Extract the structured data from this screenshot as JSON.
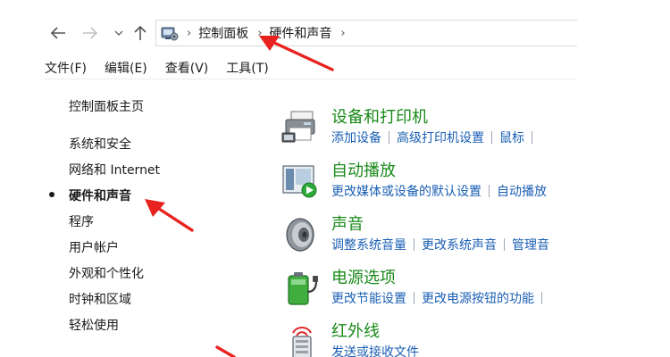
{
  "navigation": {
    "breadcrumb": [
      "控制面板",
      "硬件和声音"
    ]
  },
  "menubar": {
    "items": [
      "文件(F)",
      "编辑(E)",
      "查看(V)",
      "工具(T)"
    ]
  },
  "sidebar": {
    "home": "控制面板主页",
    "items": [
      "系统和安全",
      "网络和 Internet",
      "硬件和声音",
      "程序",
      "用户帐户",
      "外观和个性化",
      "时钟和区域",
      "轻松使用"
    ],
    "current_index": 2
  },
  "categories": [
    {
      "title": "设备和打印机",
      "icon": "printer-icon",
      "links": [
        "添加设备",
        "高级打印机设置",
        "鼠标"
      ]
    },
    {
      "title": "自动播放",
      "icon": "autoplay-icon",
      "links": [
        "更改媒体或设备的默认设置",
        "自动播放"
      ]
    },
    {
      "title": "声音",
      "icon": "speaker-icon",
      "links": [
        "调整系统音量",
        "更改系统声音",
        "管理音"
      ]
    },
    {
      "title": "电源选项",
      "icon": "battery-icon",
      "links": [
        "更改节能设置",
        "更改电源按钮的功能"
      ]
    },
    {
      "title": "红外线",
      "icon": "infrared-icon",
      "links": [
        "发送或接收文件"
      ]
    }
  ],
  "colors": {
    "category_title": "#1a8a1a",
    "link": "#1a5fb4",
    "annotation_arrow": "#e8231f"
  }
}
